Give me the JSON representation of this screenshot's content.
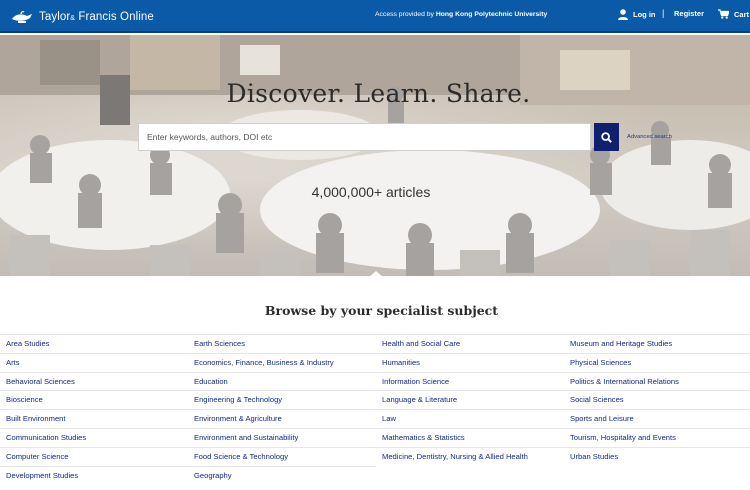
{
  "header": {
    "logo_text_1": "Taylor",
    "logo_amp": "&",
    "logo_text_2": " Francis Online",
    "access_prefix": "Access provided by ",
    "access_institution": "Hong Kong Polytechnic University",
    "login_label": "Log in",
    "separator": "|",
    "register_label": "Register",
    "cart_label": "Cart",
    "icons": [
      "logo-lamp-icon",
      "user-icon",
      "cart-icon"
    ]
  },
  "hero": {
    "title": "Discover. Learn. Share.",
    "search_placeholder": "Enter keywords, authors, DOI etc",
    "search_value": "",
    "advanced_search_label": "Advanced search",
    "articles_count": "4,000,000+ articles"
  },
  "browse": {
    "title": "Browse by your specialist subject",
    "columns": [
      [
        "Area Studies",
        "Arts",
        "Behavioral Sciences",
        "Bioscience",
        "Built Environment",
        "Communication Studies",
        "Computer Science",
        "Development Studies"
      ],
      [
        "Earth Sciences",
        "Economics, Finance, Business & Industry",
        "Education",
        "Engineering & Technology",
        "Environment & Agriculture",
        "Environment and Sustainability",
        "Food Science & Technology",
        "Geography"
      ],
      [
        "Health and Social Care",
        "Humanities",
        "Information Science",
        "Language & Literature",
        "Law",
        "Mathematics & Statistics",
        "Medicine, Dentistry, Nursing & Allied Health"
      ],
      [
        "Museum and Heritage Studies",
        "Physical Sciences",
        "Politics & International Relations",
        "Social Sciences",
        "Sports and Leisure",
        "Tourism, Hospitality and Events",
        "Urban Studies"
      ]
    ]
  },
  "colors": {
    "header_bg": "#0a5aa8",
    "search_button": "#10206e",
    "link": "#12288a"
  }
}
